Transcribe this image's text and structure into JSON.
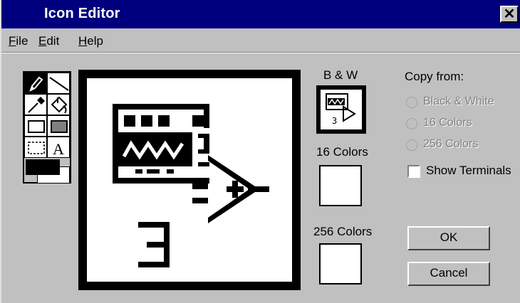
{
  "window": {
    "title": "Icon Editor",
    "close_glyph": "✕"
  },
  "menu": [
    {
      "label": "File",
      "mnemonic": "F",
      "rest": "ile"
    },
    {
      "label": "Edit",
      "mnemonic": "E",
      "rest": "dit"
    },
    {
      "label": "Help",
      "mnemonic": "H",
      "rest": "elp"
    }
  ],
  "tools": [
    "pencil-icon",
    "line-icon",
    "dropper-icon",
    "fill-bucket-icon",
    "rectangle-icon",
    "filled-rectangle-icon",
    "select-icon",
    "text-icon"
  ],
  "previews": {
    "bw_label": "B & W",
    "c16_label": "16 Colors",
    "c256_label": "256 Colors",
    "icon_number": "3"
  },
  "copy_from": {
    "label": "Copy from:",
    "options": [
      "Black & White",
      "16 Colors",
      "256 Colors"
    ],
    "show_terminals": "Show Terminals",
    "show_terminals_checked": false
  },
  "buttons": {
    "ok": "OK",
    "cancel": "Cancel"
  },
  "colors": {
    "title_bar": "#00007f",
    "face": "#c0c0c0",
    "foreground": "#000000",
    "background": "#ffffff"
  }
}
